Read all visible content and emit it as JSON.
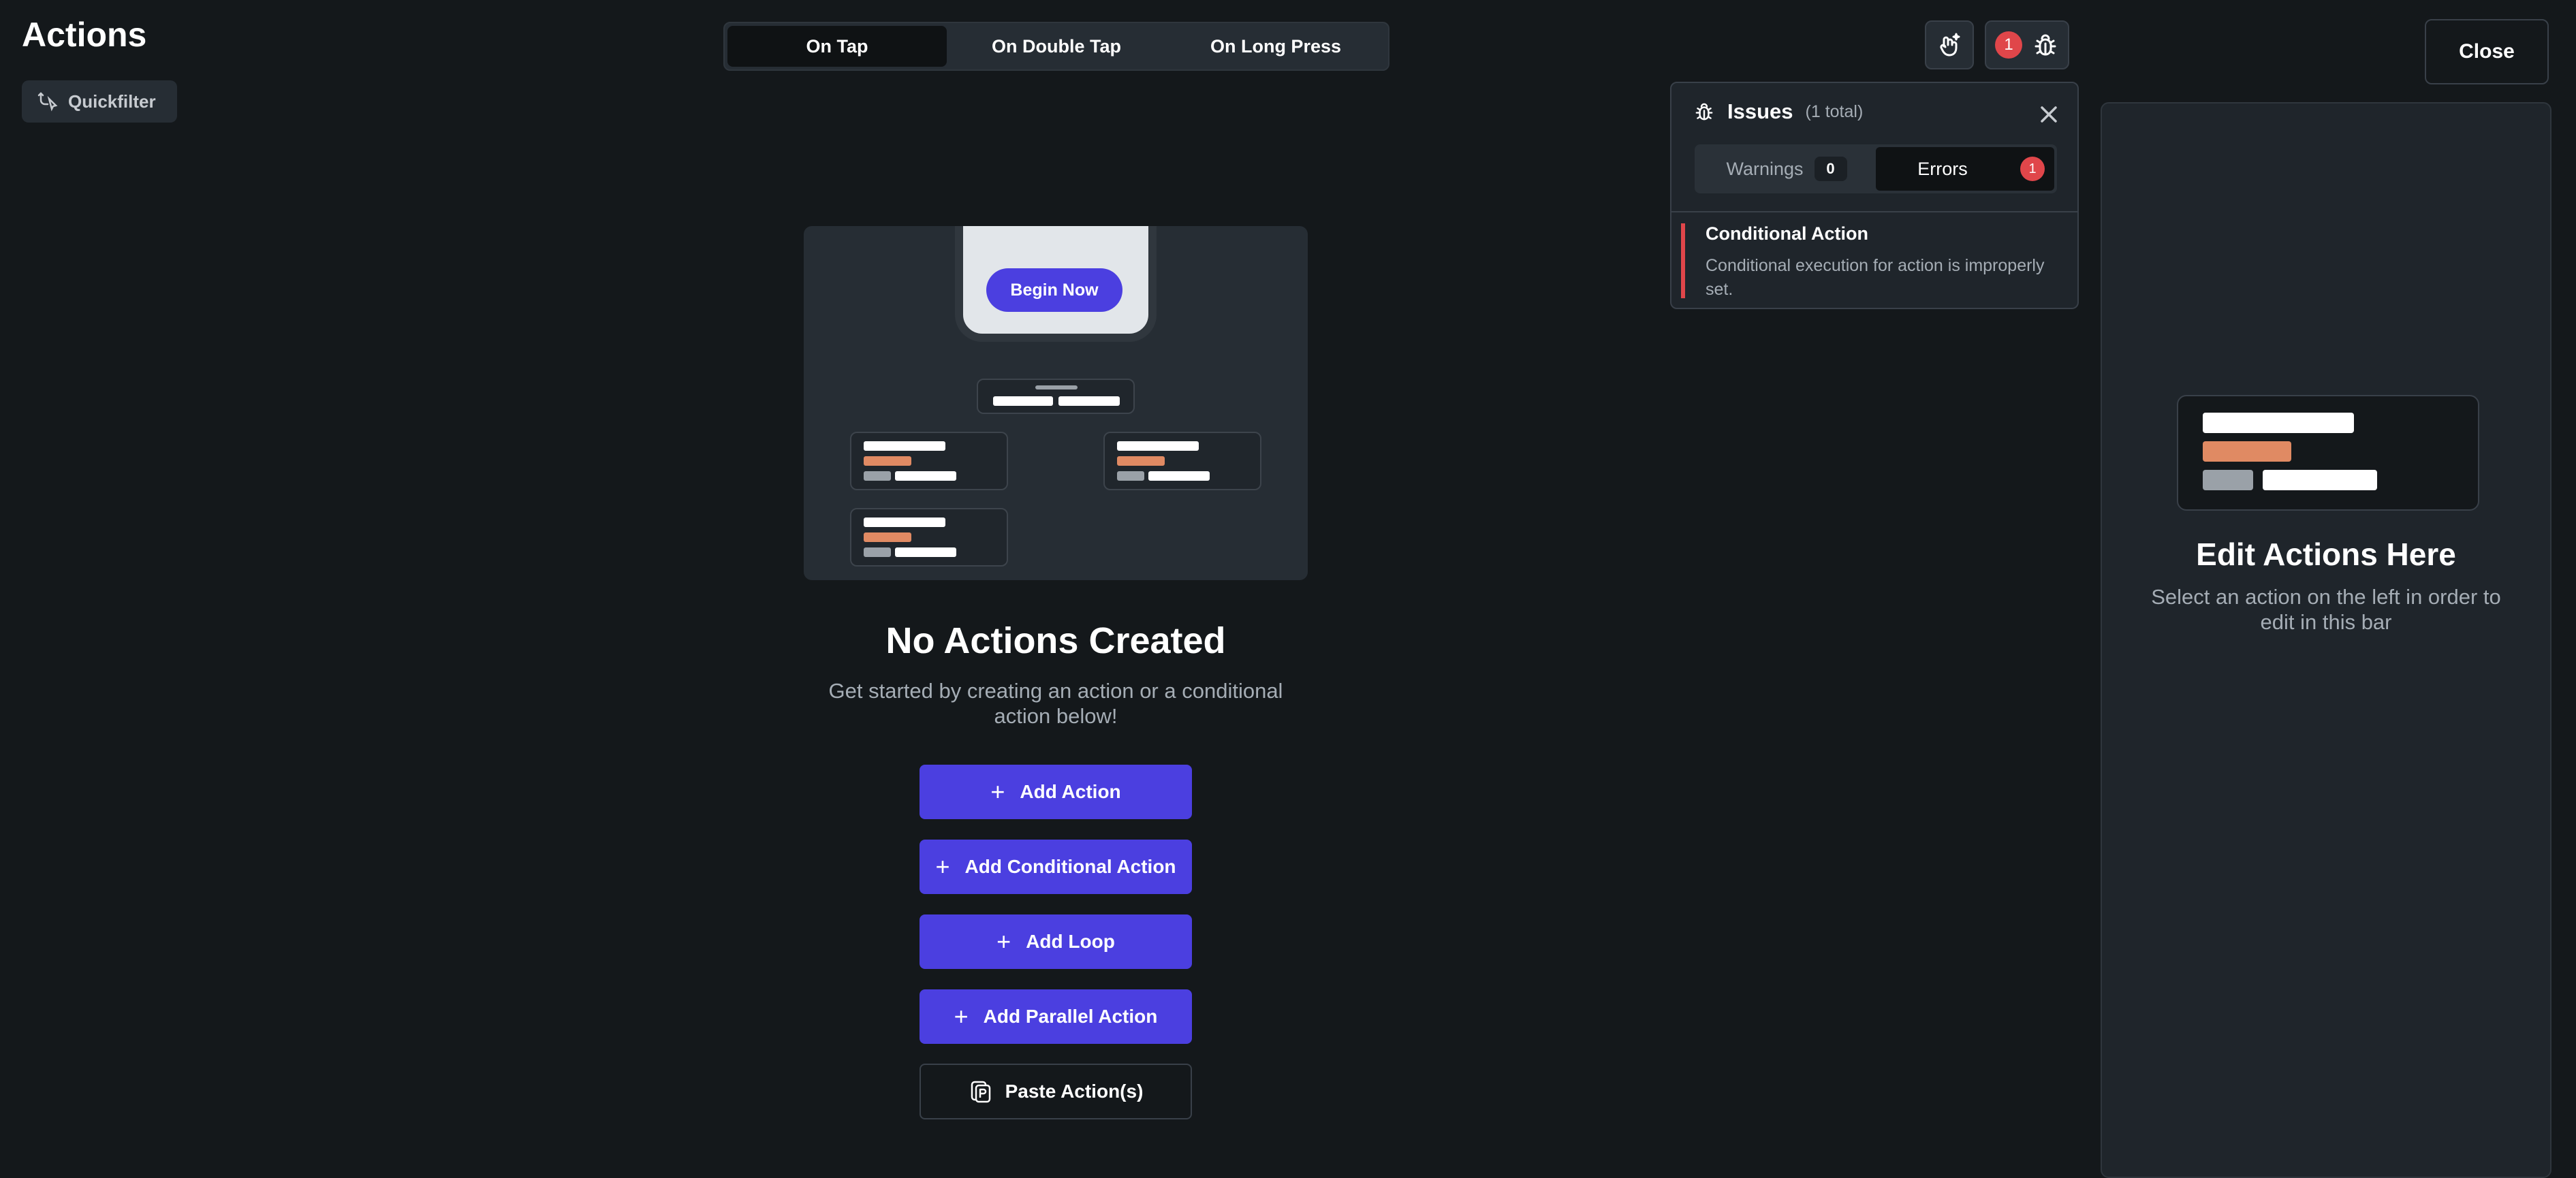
{
  "header": {
    "title": "Actions",
    "quickfilter_label": "Quickfilter"
  },
  "tabs": [
    {
      "label": "On Tap",
      "active": true
    },
    {
      "label": "On Double Tap",
      "active": false
    },
    {
      "label": "On Long Press",
      "active": false
    }
  ],
  "toolbar": {
    "issues_badge": "1",
    "close_label": "Close"
  },
  "issues_panel": {
    "title": "Issues",
    "count_text": "(1 total)",
    "tabs": [
      {
        "label": "Warnings",
        "count": "0",
        "active": false
      },
      {
        "label": "Errors",
        "count": "1",
        "active": true
      }
    ],
    "items": [
      {
        "name": "Conditional Action",
        "description": "Conditional execution for action is improperly set."
      }
    ]
  },
  "illustration": {
    "button_label": "Begin Now"
  },
  "empty_state": {
    "title": "No Actions Created",
    "description": "Get started by creating an action or a conditional action below!"
  },
  "buttons": {
    "add_action": "Add Action",
    "add_conditional": "Add Conditional Action",
    "add_loop": "Add Loop",
    "add_parallel": "Add Parallel Action",
    "paste": "Paste Action(s)"
  },
  "right_panel": {
    "title": "Edit Actions Here",
    "description": "Select an action on the left in order to edit in this bar"
  },
  "colors": {
    "background": "#14181b",
    "accent": "#4b3fe0",
    "error": "#e0464a",
    "orange": "#e08a63"
  }
}
